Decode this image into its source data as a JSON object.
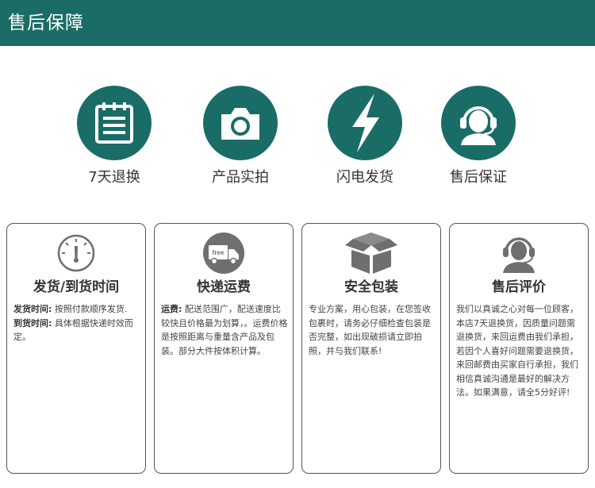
{
  "header": {
    "title": "售后保障"
  },
  "features": [
    {
      "icon": "calendar-icon",
      "label": "7天退换"
    },
    {
      "icon": "camera-icon",
      "label": "产品实拍"
    },
    {
      "icon": "lightning-icon",
      "label": "闪电发货"
    },
    {
      "icon": "customer-service-icon",
      "label": "售后保证"
    }
  ],
  "cards": [
    {
      "icon": "speedometer-icon",
      "title": "发货/到货时间",
      "lines": [
        {
          "label": "发货时间:",
          "text": "按照付款顺序发货."
        },
        {
          "label": "到货时间:",
          "text": "具体根据快递时效而定。"
        }
      ]
    },
    {
      "icon": "free-truck-icon",
      "icon_text": "free",
      "title": "快递运费",
      "label": "运费:",
      "text": "配送范围广，配送速度比较快且价格最为划算，。运费价格是按照距离与重量含产品及包装。部分大件按体积计算。"
    },
    {
      "icon": "package-box-icon",
      "title": "安全包装",
      "text": "专业方案，用心包装，在您签收包裹时，请务必仔细检查包装是否完整，如出现破损请立即拍照，并与我们联系!"
    },
    {
      "icon": "headset-person-icon",
      "title": "售后评价",
      "text": "我们以真诚之心对每一位顾客，本店7天退换货，因质量问题需退换货，来回运费由我们承担，若因个人喜好问题需要退换货，来回邮费由买家自行承担，我们相信真诚沟通是最好的解决方法。如果满意，请全5分好评!"
    }
  ],
  "colors": {
    "brand": "#1a6d66",
    "card_border": "#555555",
    "icon_gray": "#6f6f6f"
  }
}
